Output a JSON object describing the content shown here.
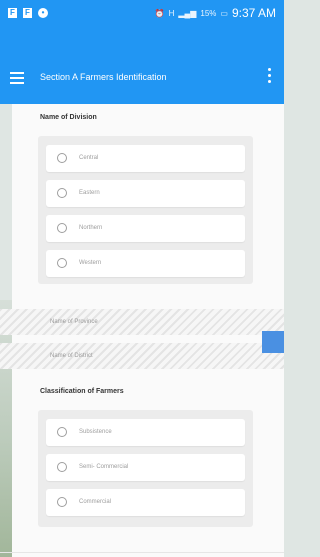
{
  "status_bar": {
    "left_icons": [
      "F",
      "F",
      "•"
    ],
    "signal_text": "H",
    "battery": "15%",
    "time": "9:37 AM"
  },
  "app_bar": {
    "title": "Section A Farmers Identification"
  },
  "division": {
    "label": "Name of Division",
    "options": [
      "Central",
      "Eastern",
      "Northern",
      "Western"
    ]
  },
  "province": {
    "label": "Name of Province"
  },
  "district": {
    "label": "Name of District"
  },
  "classification": {
    "label": "Classification of Farmers",
    "options": [
      "Subsistence",
      "Semi- Commercial",
      "Commercial"
    ]
  }
}
